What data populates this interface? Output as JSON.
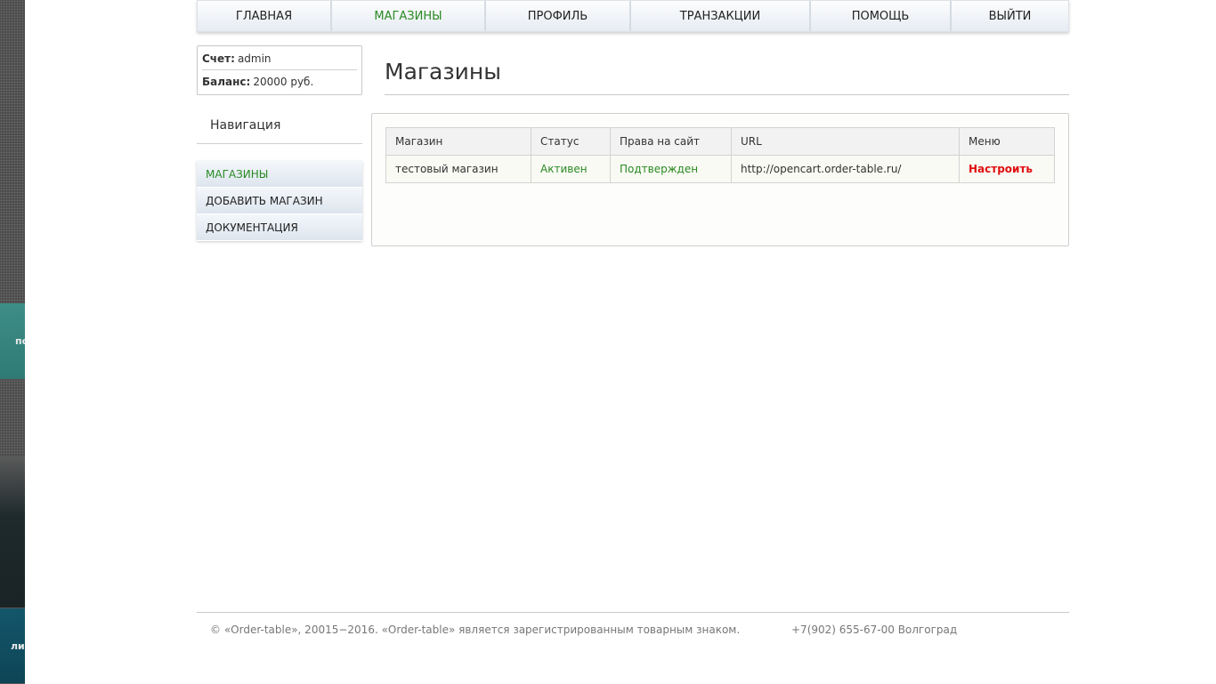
{
  "left_strip": {
    "label_1": "по",
    "label_2": "ли"
  },
  "nav": {
    "items": [
      {
        "label": "ГЛАВНАЯ"
      },
      {
        "label": "МАГАЗИНЫ"
      },
      {
        "label": "ПРОФИЛЬ"
      },
      {
        "label": "ТРАНЗАКЦИИ"
      },
      {
        "label": "ПОМОЩЬ"
      },
      {
        "label": "ВЫЙТИ"
      }
    ],
    "active_index": 1,
    "active_color": "#2a8a24"
  },
  "account": {
    "account_label": "Счет:",
    "account_value": "admin",
    "balance_label": "Баланс:",
    "balance_value": "20000 руб."
  },
  "sidebar": {
    "title": "Навигация",
    "items": [
      {
        "label": "МАГАЗИНЫ"
      },
      {
        "label": "ДОБАВИТЬ МАГАЗИН"
      },
      {
        "label": "ДОКУМЕНТАЦИЯ"
      }
    ],
    "active_index": 0
  },
  "main": {
    "title": "Магазины",
    "table": {
      "headers": [
        "Магазин",
        "Статус",
        "Права на сайт",
        "URL",
        "Меню"
      ],
      "rows": [
        {
          "store": "тестовый магазин",
          "status": "Активен",
          "rights": "Подтвержден",
          "url": "http://opencart.order-table.ru/",
          "menu": "Настроить"
        }
      ]
    },
    "status_color": "#2a8a24",
    "menu_link_color": "#e01010"
  },
  "footer": {
    "copyright": "© «Order-table», 20015−2016. «Order-table» является зарегистрированным товарным знаком.",
    "contact": "+7(902) 655-67-00 Волгоград"
  }
}
